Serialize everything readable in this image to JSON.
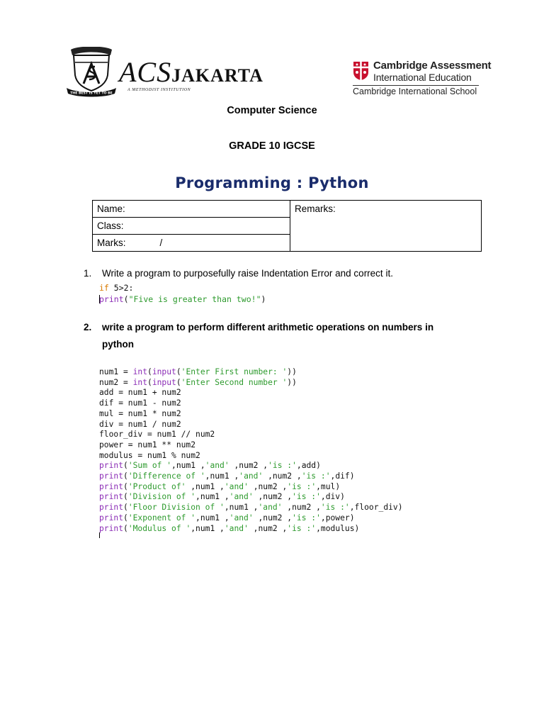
{
  "header": {
    "acs_logo": {
      "word_part1": "ACS",
      "word_part2": "JAKARTA",
      "tagline": "A METHODIST INSTITUTION",
      "crest_motto": "THE BEST IS YET TO BE"
    },
    "cambridge_logo": {
      "line1": "Cambridge Assessment",
      "line2": "International Education",
      "line3": "Cambridge International School"
    }
  },
  "subject": "Computer Science",
  "grade": "GRADE 10 IGCSE",
  "title": "Programming : Python",
  "info_table": {
    "name_label": "Name:",
    "remarks_label": "Remarks:",
    "class_label": "Class:",
    "marks_label": "Marks:",
    "marks_slash": "/"
  },
  "questions": [
    {
      "number": "1.",
      "text": "Write a program to purposefully raise Indentation Error and correct it."
    },
    {
      "number": "2.",
      "text_line1": "write a program to perform different arithmetic operations on numbers in",
      "text_line2": "python"
    }
  ],
  "code1": {
    "line1_kw": "if",
    "line1_rest": " 5>2:",
    "line2_fn": "print",
    "line2_open": "(",
    "line2_str": "\"Five is greater than two!\"",
    "line2_close": ")"
  },
  "code2": {
    "lines": [
      [
        [
          "t",
          "num1 = "
        ],
        [
          "fn",
          "int"
        ],
        [
          "t",
          "("
        ],
        [
          "fn",
          "input"
        ],
        [
          "t",
          "("
        ],
        [
          "st",
          "'Enter First number: '"
        ],
        [
          "t",
          "))"
        ]
      ],
      [
        [
          "t",
          "num2 = "
        ],
        [
          "fn",
          "int"
        ],
        [
          "t",
          "("
        ],
        [
          "fn",
          "input"
        ],
        [
          "t",
          "("
        ],
        [
          "st",
          "'Enter Second number '"
        ],
        [
          "t",
          "))"
        ]
      ],
      [
        [
          "t",
          "add = num1 + num2"
        ]
      ],
      [
        [
          "t",
          "dif = num1 - num2"
        ]
      ],
      [
        [
          "t",
          "mul = num1 * num2"
        ]
      ],
      [
        [
          "t",
          "div = num1 / num2"
        ]
      ],
      [
        [
          "t",
          "floor_div = num1 // num2"
        ]
      ],
      [
        [
          "t",
          "power = num1 ** num2"
        ]
      ],
      [
        [
          "t",
          "modulus = num1 % num2"
        ]
      ],
      [
        [
          "fn",
          "print"
        ],
        [
          "t",
          "("
        ],
        [
          "st",
          "'Sum of '"
        ],
        [
          "t",
          ",num1 ,"
        ],
        [
          "st",
          "'and'"
        ],
        [
          "t",
          " ,num2 ,"
        ],
        [
          "st",
          "'is :'"
        ],
        [
          "t",
          ",add)"
        ]
      ],
      [
        [
          "fn",
          "print"
        ],
        [
          "t",
          "("
        ],
        [
          "st",
          "'Difference of '"
        ],
        [
          "t",
          ",num1 ,"
        ],
        [
          "st",
          "'and'"
        ],
        [
          "t",
          " ,num2 ,"
        ],
        [
          "st",
          "'is :'"
        ],
        [
          "t",
          ",dif)"
        ]
      ],
      [
        [
          "fn",
          "print"
        ],
        [
          "t",
          "("
        ],
        [
          "st",
          "'Product of'"
        ],
        [
          "t",
          " ,num1 ,"
        ],
        [
          "st",
          "'and'"
        ],
        [
          "t",
          " ,num2 ,"
        ],
        [
          "st",
          "'is :'"
        ],
        [
          "t",
          ",mul)"
        ]
      ],
      [
        [
          "fn",
          "print"
        ],
        [
          "t",
          "("
        ],
        [
          "st",
          "'Division of '"
        ],
        [
          "t",
          ",num1 ,"
        ],
        [
          "st",
          "'and'"
        ],
        [
          "t",
          " ,num2 ,"
        ],
        [
          "st",
          "'is :'"
        ],
        [
          "t",
          ",div)"
        ]
      ],
      [
        [
          "fn",
          "print"
        ],
        [
          "t",
          "("
        ],
        [
          "st",
          "'Floor Division of '"
        ],
        [
          "t",
          ",num1 ,"
        ],
        [
          "st",
          "'and'"
        ],
        [
          "t",
          " ,num2 ,"
        ],
        [
          "st",
          "'is :'"
        ],
        [
          "t",
          ",floor_div)"
        ]
      ],
      [
        [
          "fn",
          "print"
        ],
        [
          "t",
          "("
        ],
        [
          "st",
          "'Exponent of '"
        ],
        [
          "t",
          ",num1 ,"
        ],
        [
          "st",
          "'and'"
        ],
        [
          "t",
          " ,num2 ,"
        ],
        [
          "st",
          "'is :'"
        ],
        [
          "t",
          ",power)"
        ]
      ],
      [
        [
          "fn",
          "print"
        ],
        [
          "t",
          "("
        ],
        [
          "st",
          "'Modulus of '"
        ],
        [
          "t",
          ",num1 ,"
        ],
        [
          "st",
          "'and'"
        ],
        [
          "t",
          " ,num2 ,"
        ],
        [
          "st",
          "'is :'"
        ],
        [
          "t",
          ",modulus)"
        ]
      ]
    ]
  },
  "colors": {
    "title": "#1a2c6b",
    "keyword": "#d97a00",
    "function": "#8a2bb5",
    "string": "#2d9a2d",
    "cambridge_red": "#c8102e"
  }
}
